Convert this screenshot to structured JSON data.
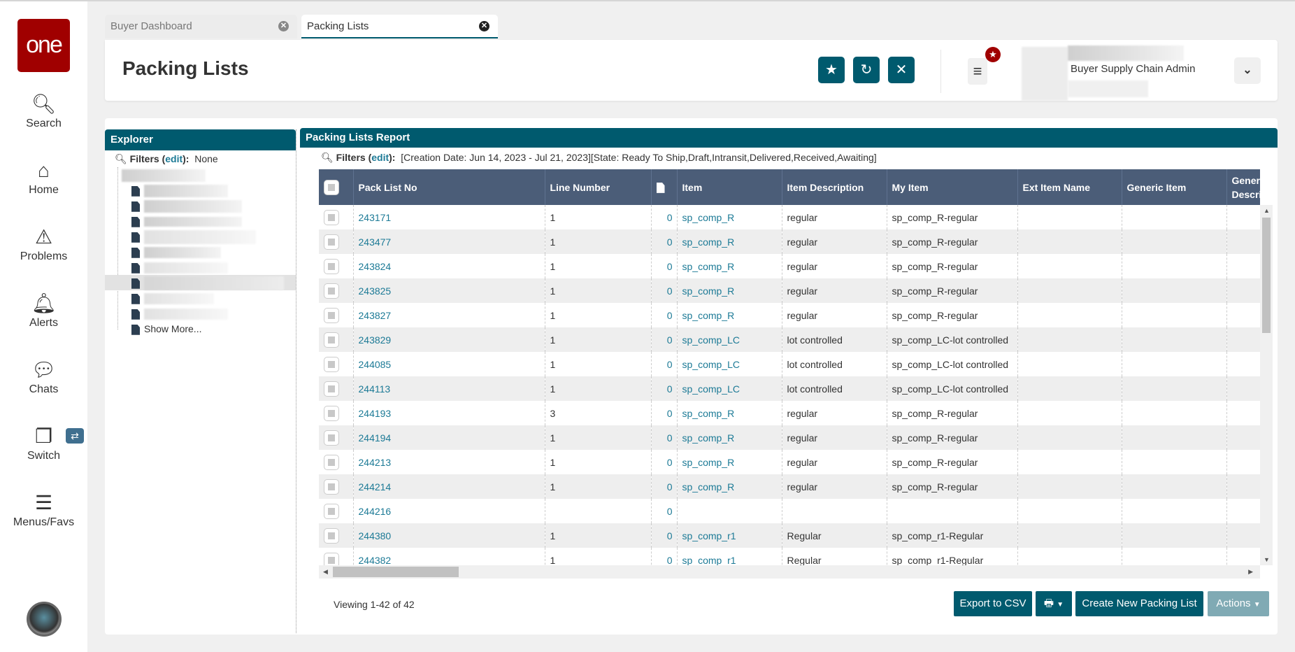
{
  "sidebar": {
    "logo": "one",
    "items": [
      {
        "label": "Search",
        "icon": "search-icon"
      },
      {
        "label": "Home",
        "icon": "home-icon"
      },
      {
        "label": "Problems",
        "icon": "warning-icon"
      },
      {
        "label": "Alerts",
        "icon": "bell-icon"
      },
      {
        "label": "Chats",
        "icon": "chat-icon"
      },
      {
        "label": "Switch",
        "icon": "switch-icon"
      },
      {
        "label": "Menus/Favs",
        "icon": "menu-icon"
      }
    ]
  },
  "tabs": [
    {
      "label": "Buyer Dashboard",
      "active": false
    },
    {
      "label": "Packing Lists",
      "active": true
    }
  ],
  "header": {
    "title": "Packing Lists",
    "role": "Buyer Supply Chain Admin"
  },
  "explorer": {
    "title": "Explorer",
    "filters_label": "Filters",
    "edit": "edit",
    "filters_value": "None",
    "show_more": "Show More..."
  },
  "report": {
    "title": "Packing Lists Report",
    "filters_label": "Filters",
    "edit": "edit",
    "filters_value": "[Creation Date: Jun 14, 2023 - Jul 21, 2023][State: Ready To Ship,Draft,Intransit,Delivered,Received,Awaiting]",
    "columns": [
      "Pack List No",
      "Line Number",
      "",
      "Item",
      "Item Description",
      "My Item",
      "Ext Item Name",
      "Generic Item",
      "Generic Description"
    ],
    "rows": [
      [
        "243171",
        "1",
        "0",
        "sp_comp_R",
        "regular",
        "sp_comp_R-regular"
      ],
      [
        "243477",
        "1",
        "0",
        "sp_comp_R",
        "regular",
        "sp_comp_R-regular"
      ],
      [
        "243824",
        "1",
        "0",
        "sp_comp_R",
        "regular",
        "sp_comp_R-regular"
      ],
      [
        "243825",
        "1",
        "0",
        "sp_comp_R",
        "regular",
        "sp_comp_R-regular"
      ],
      [
        "243827",
        "1",
        "0",
        "sp_comp_R",
        "regular",
        "sp_comp_R-regular"
      ],
      [
        "243829",
        "1",
        "0",
        "sp_comp_LC",
        "lot controlled",
        "sp_comp_LC-lot controlled"
      ],
      [
        "244085",
        "1",
        "0",
        "sp_comp_LC",
        "lot controlled",
        "sp_comp_LC-lot controlled"
      ],
      [
        "244113",
        "1",
        "0",
        "sp_comp_LC",
        "lot controlled",
        "sp_comp_LC-lot controlled"
      ],
      [
        "244193",
        "3",
        "0",
        "sp_comp_R",
        "regular",
        "sp_comp_R-regular"
      ],
      [
        "244194",
        "1",
        "0",
        "sp_comp_R",
        "regular",
        "sp_comp_R-regular"
      ],
      [
        "244213",
        "1",
        "0",
        "sp_comp_R",
        "regular",
        "sp_comp_R-regular"
      ],
      [
        "244214",
        "1",
        "0",
        "sp_comp_R",
        "regular",
        "sp_comp_R-regular"
      ],
      [
        "244216",
        "",
        "0",
        "",
        "",
        ""
      ],
      [
        "244380",
        "1",
        "0",
        "sp_comp_r1",
        "Regular",
        "sp_comp_r1-Regular"
      ],
      [
        "244382",
        "1",
        "0",
        "sp_comp_r1",
        "Regular",
        "sp_comp_r1-Regular"
      ]
    ],
    "viewing": "Viewing 1-42 of 42"
  },
  "footer": {
    "export": "Export to CSV",
    "create": "Create New Packing List",
    "actions": "Actions"
  },
  "colors": {
    "primary": "#005a6e",
    "table_header": "#4b5d78",
    "link": "#1c7a96",
    "logo": "#a00000"
  }
}
